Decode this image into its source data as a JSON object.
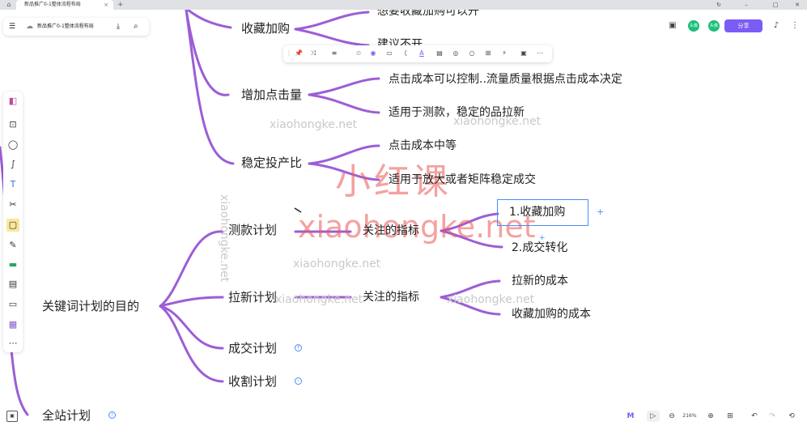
{
  "window": {
    "tab_title": "新品推广0-1整体流程布局",
    "tab_close": "×",
    "tab_add": "+",
    "home_icon": "⌂",
    "controls": [
      "↻",
      "–",
      "□",
      "✕"
    ]
  },
  "doc_toolbar": {
    "menu_icon": "☰",
    "cloud_icon": "☁",
    "title": "新品推广0-1整体流程布局",
    "save_icon": "⤓",
    "search_icon": "⌕"
  },
  "top_right": {
    "present_icon": "▣",
    "avatar1": "头像",
    "avatar2": "头像",
    "share_label": "分享",
    "bell_icon": "♪",
    "more_icon": "⋮"
  },
  "format_toolbar": {
    "items": [
      "⋮",
      "📌",
      "⤨",
      "≡",
      "⊘",
      "◉",
      "▭",
      "⟨",
      "A",
      "▤",
      "◎",
      "○",
      "⊞",
      "⚡",
      "▣",
      "⋯"
    ]
  },
  "left_tools": [
    "◧",
    "⊡",
    "◯",
    "∫",
    "T",
    "✂",
    "▢",
    "✎",
    "▬",
    "▤",
    "▭",
    "▦",
    "⋯"
  ],
  "mindmap": {
    "root": "关键词计划的目的",
    "branch_top_1": "收藏加购",
    "top_1_child_a": "想要收藏加购可以开",
    "top_1_child_b": "建议不开",
    "branch_top_2": "增加点击量",
    "top_2_child_a": "点击成本可以控制..流量质量根据点击成本决定",
    "top_2_child_b": "适用于测款，稳定的品拉新",
    "branch_top_3": "稳定投产比",
    "top_3_child_a": "点击成本中等",
    "top_3_child_b": "适用于放大或者矩阵稳定成交",
    "plan_test": "测款计划",
    "plan_test_focus": "关注的指标",
    "plan_test_item_1": "1.收藏加购",
    "plan_test_item_2": "2.成交转化",
    "plan_new": "拉新计划",
    "plan_new_focus": "关注的指标",
    "plan_new_item_1": "拉新的成本",
    "plan_new_item_2": "收藏加购的成本",
    "plan_deal": "成交计划",
    "plan_harvest": "收割计划",
    "full_site": "全站计划",
    "add_icon": "+",
    "collapsed_icon": "↑",
    "expand_icon": "›",
    "info_icon": "!"
  },
  "watermarks": {
    "cn_big": "小红课",
    "en_big": "xiaohongke.net",
    "small": "xiaohongke.net"
  },
  "bottom_bar": {
    "ai_icon": "M",
    "pointer_icon": "▷",
    "zoom_out_icon": "⊖",
    "zoom_level": "216%",
    "zoom_in_icon": "⊕",
    "fit_icon": "⊞",
    "undo_icon": "↶",
    "redo_icon": "↷",
    "history_icon": "⟲",
    "outline_icon": "▣"
  },
  "colors": {
    "branch": "#9c5ed6",
    "selection": "#4a8df8",
    "share": "#7b5cf5"
  }
}
